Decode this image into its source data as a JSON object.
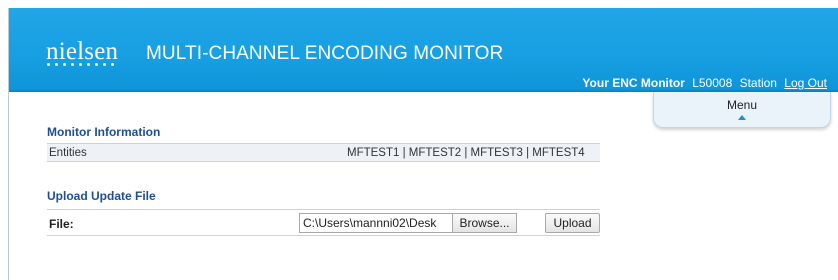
{
  "header": {
    "logo_text": "nielsen",
    "title": "MULTI-CHANNEL ENCODING MONITOR",
    "monitor_label": "Your ENC Monitor",
    "monitor_id": "L50008",
    "station_label": "Station",
    "logout_label": "Log Out"
  },
  "menu": {
    "label": "Menu"
  },
  "monitor_info": {
    "title": "Monitor Information",
    "rows": [
      {
        "label": "Entities",
        "value": "MFTEST1 | MFTEST2 | MFTEST3 | MFTEST4"
      }
    ]
  },
  "upload": {
    "title": "Upload Update File",
    "file_label": "File:",
    "file_value": "C:\\Users\\mannni02\\Desk",
    "browse_label": "Browse...",
    "upload_label": "Upload"
  }
}
